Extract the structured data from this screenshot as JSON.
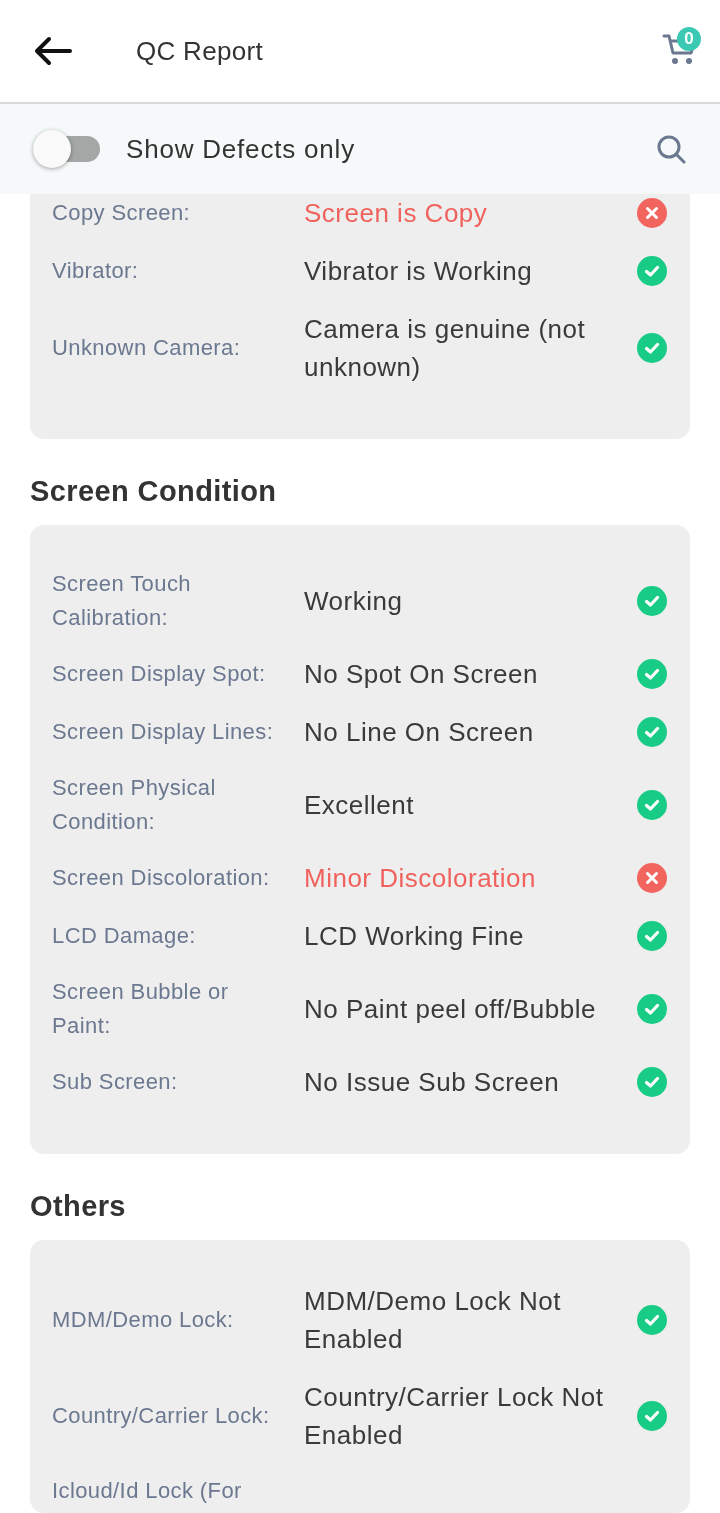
{
  "header": {
    "title": "QC Report",
    "cart_count": "0"
  },
  "filter": {
    "label": "Show Defects only",
    "on": false
  },
  "sections": [
    {
      "rows": [
        {
          "label": "Copy Screen:",
          "value": "Screen is Copy",
          "defect": true
        },
        {
          "label": "Vibrator:",
          "value": "Vibrator is Working",
          "defect": false
        },
        {
          "label": "Unknown Camera:",
          "value": "Camera is genuine (not unknown)",
          "defect": false
        }
      ]
    },
    {
      "title": "Screen Condition",
      "rows": [
        {
          "label": "Screen Touch Calibration:",
          "value": "Working",
          "defect": false
        },
        {
          "label": "Screen Display Spot:",
          "value": "No Spot On Screen",
          "defect": false
        },
        {
          "label": "Screen Display Lines:",
          "value": "No Line On Screen",
          "defect": false
        },
        {
          "label": "Screen Physical Condition:",
          "value": "Excellent",
          "defect": false
        },
        {
          "label": "Screen Discoloration:",
          "value": "Minor Discoloration",
          "defect": true
        },
        {
          "label": "LCD Damage:",
          "value": "LCD Working Fine",
          "defect": false
        },
        {
          "label": "Screen Bubble or Paint:",
          "value": "No Paint peel off/Bubble",
          "defect": false
        },
        {
          "label": "Sub Screen:",
          "value": "No Issue Sub Screen",
          "defect": false
        }
      ]
    },
    {
      "title": "Others",
      "rows": [
        {
          "label": "MDM/Demo Lock:",
          "value": "MDM/Demo Lock Not Enabled",
          "defect": false
        },
        {
          "label": "Country/Carrier Lock:",
          "value": "Country/Carrier Lock Not Enabled",
          "defect": false
        },
        {
          "label": "Icloud/Id Lock (For"
        }
      ]
    }
  ]
}
